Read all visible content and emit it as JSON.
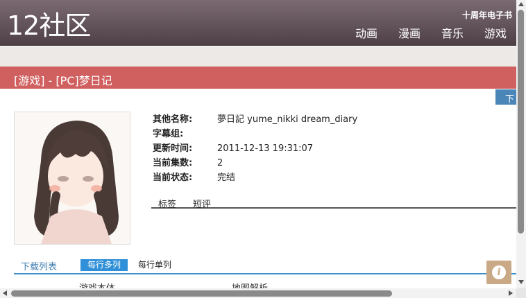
{
  "header": {
    "logo": "12社区",
    "tagline": "十周年电子书",
    "nav": [
      "动画",
      "漫画",
      "音乐",
      "游戏"
    ]
  },
  "title": "[游戏] - [PC]梦日记",
  "download_tab": "下",
  "info": {
    "rows": [
      {
        "key": "其他名称:",
        "value": "夢日記 yume_nikki dream_diary"
      },
      {
        "key": "字幕组:",
        "value": ""
      },
      {
        "key": "更新时间:",
        "value": "2011-12-13 19:31:07"
      },
      {
        "key": "当前集数:",
        "value": "2"
      },
      {
        "key": "当前状态:",
        "value": "完结"
      }
    ],
    "tabs": [
      "标签",
      "短评"
    ]
  },
  "downloads": {
    "title": "下载列表",
    "view_multi": "每行多列",
    "view_single": "每行单列",
    "columns": [
      "游戏本体",
      "地图解析"
    ]
  },
  "colors": {
    "header": "#5f4f57",
    "title_bar": "#d05f5f",
    "accent_blue": "#2f8fd8",
    "info_button": "#c9a986"
  },
  "icons": {
    "info": "info-icon"
  },
  "info_icon_glyph": "i"
}
